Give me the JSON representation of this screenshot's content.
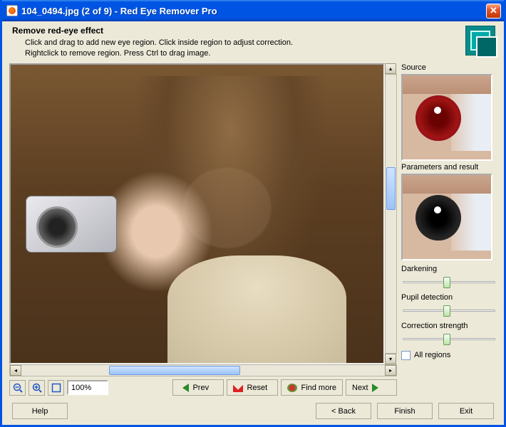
{
  "title": "104_0494.jpg (2 of 9) - Red Eye Remover Pro",
  "instr": {
    "heading": "Remove red-eye effect",
    "line1": "Click and drag to add new eye region. Click inside region to adjust correction.",
    "line2": "Rightclick to remove region. Press Ctrl to drag image."
  },
  "side": {
    "source": "Source",
    "params": "Parameters and result",
    "darkening": "Darkening",
    "pupil": "Pupil detection",
    "strength": "Correction strength",
    "allregions": "All regions"
  },
  "sliders": {
    "darkening": 48,
    "pupil": 48,
    "strength": 48
  },
  "toolbar": {
    "zoom": "100%",
    "prev": "Prev",
    "reset": "Reset",
    "findmore": "Find more",
    "next": "Next"
  },
  "footer": {
    "help": "Help",
    "back": "< Back",
    "finish": "Finish",
    "exit": "Exit"
  }
}
